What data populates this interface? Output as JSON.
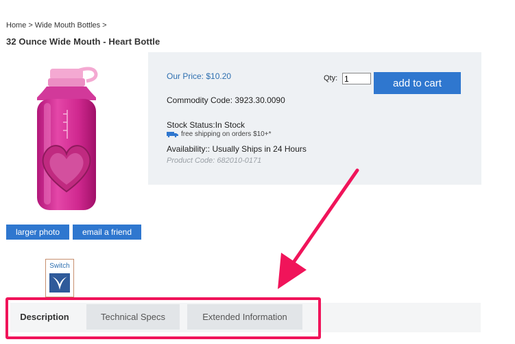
{
  "breadcrumb": {
    "home": "Home",
    "separator": ">",
    "category": "Wide Mouth Bottles",
    "trailing": ">"
  },
  "product": {
    "title": "32 Ounce Wide Mouth - Heart Bottle",
    "price_label": "Our Price: ",
    "price": "$10.20",
    "commodity": "Commodity Code: 3923.30.0090",
    "stock": "Stock Status:In Stock",
    "shipping": "free shipping on orders $10+*",
    "availability": "Availability:: Usually Ships in 24 Hours",
    "product_code": "Product Code: 682010-0171"
  },
  "cart": {
    "qty_label": "Qty:",
    "qty_value": "1",
    "add_label": "add to cart"
  },
  "photo_buttons": {
    "larger": "larger photo",
    "email": "email a friend"
  },
  "switch_badge": {
    "label": "Switch"
  },
  "tabs": [
    {
      "label": "Description",
      "active": true
    },
    {
      "label": "Technical Specs",
      "active": false
    },
    {
      "label": "Extended Information",
      "active": false
    }
  ],
  "colors": {
    "accent_blue": "#2f77cf",
    "highlight_pink": "#f0145a",
    "bottle_pink": "#e0359e",
    "panel_bg": "#eef1f4"
  }
}
